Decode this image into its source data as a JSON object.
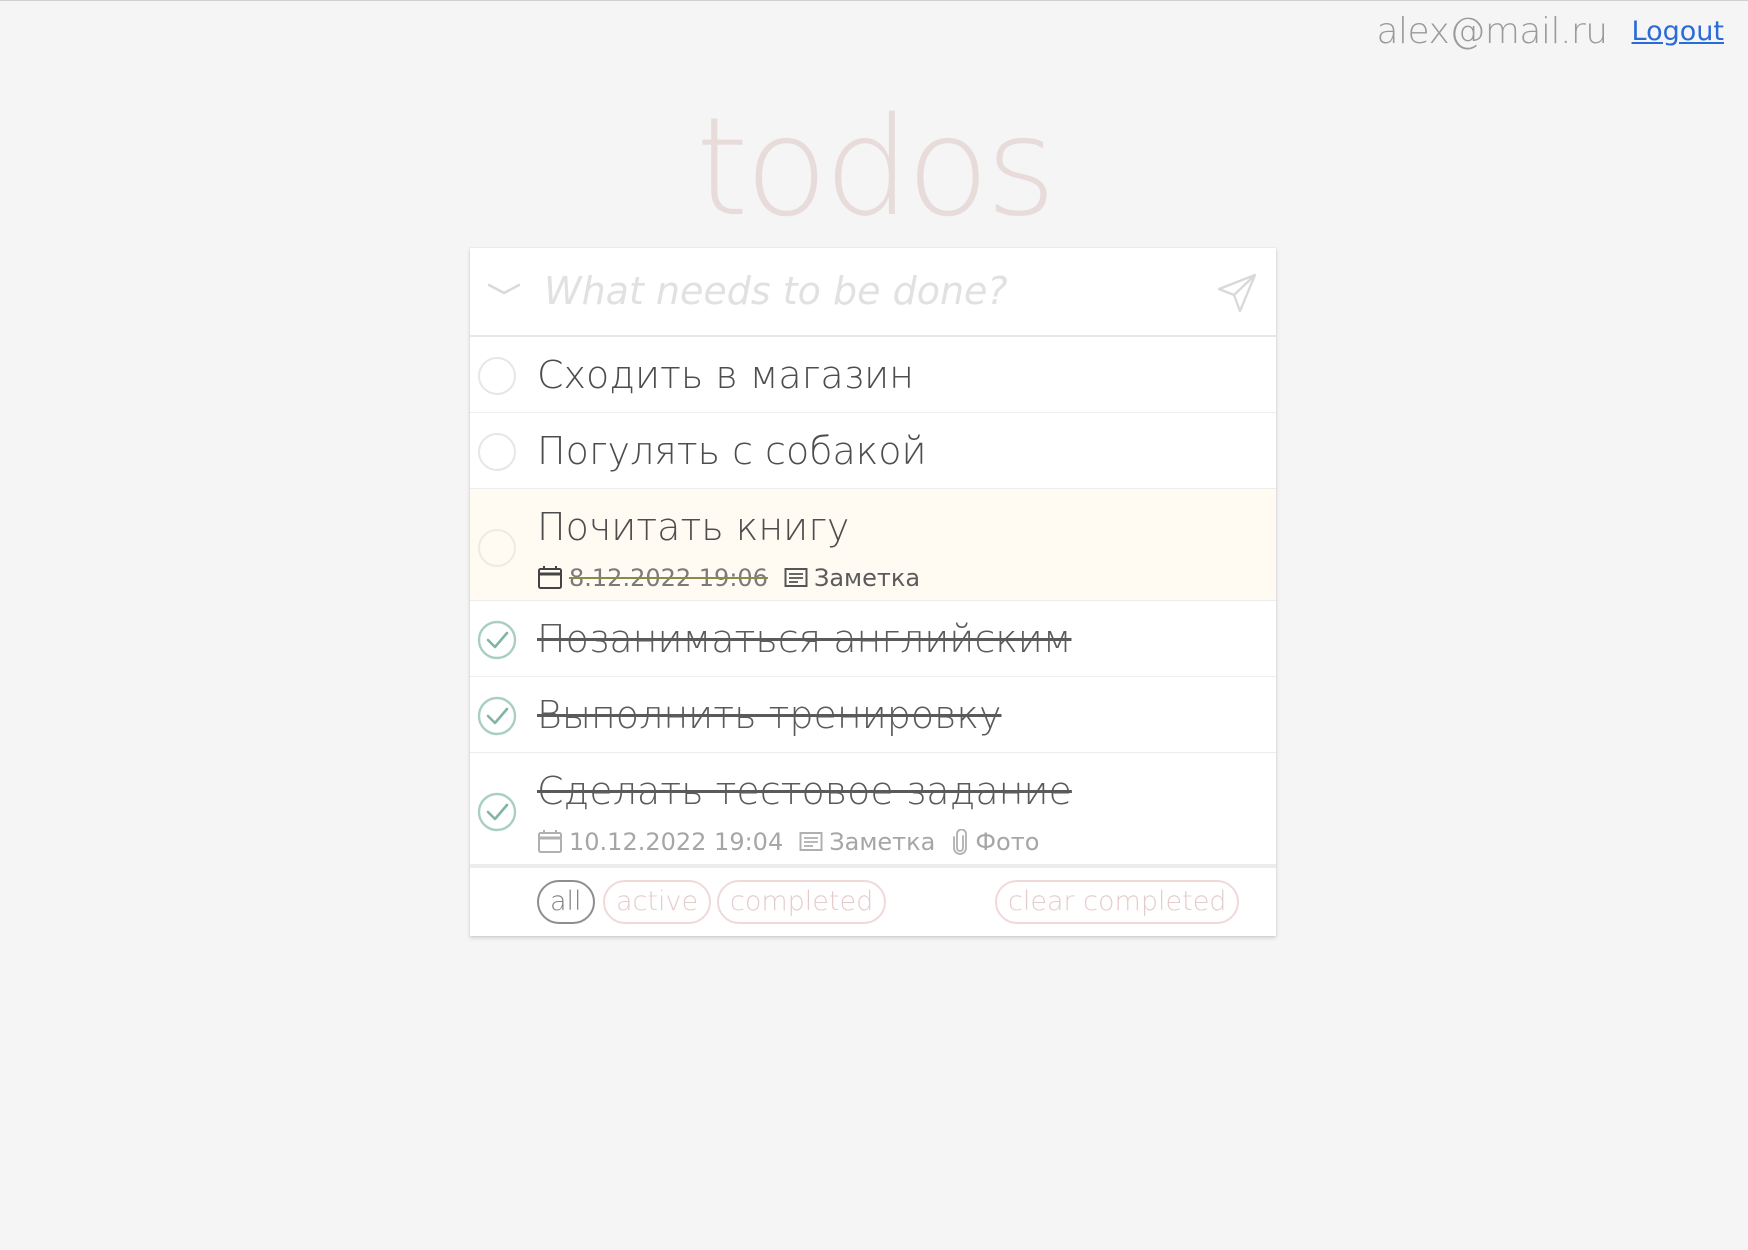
{
  "header": {
    "user_email": "alex@mail.ru",
    "logout_label": "Logout"
  },
  "brand": "todos",
  "new_todo": {
    "placeholder": "What needs to be done?",
    "value": ""
  },
  "todos": [
    {
      "title": "Сходить в магазин",
      "completed": false
    },
    {
      "title": "Погулять с собакой",
      "completed": false
    },
    {
      "title": "Почитать книгу",
      "completed": false,
      "highlighted": true,
      "date": "8.12.2022 19:06",
      "date_overdue": true,
      "note_label": "Заметка"
    },
    {
      "title": "Позаниматься английским",
      "completed": true
    },
    {
      "title": "Выполнить тренировку",
      "completed": true
    },
    {
      "title": "Сделать тестовое задание",
      "completed": true,
      "date": "10.12.2022 19:04",
      "note_label": "Заметка",
      "attachment_label": "Фото"
    }
  ],
  "footer": {
    "filters": [
      {
        "label": "all",
        "selected": true
      },
      {
        "label": "active",
        "selected": false
      },
      {
        "label": "completed",
        "selected": false
      }
    ],
    "clear_label": "clear completed"
  },
  "colors": {
    "background": "#f5f5f5",
    "brand": "#e8dcdb",
    "check_green": "#8fbfae",
    "link_blue": "#2a6bd8",
    "highlight_row": "#fffbf3"
  },
  "icons": {
    "toggle_all": "chevron-down-icon",
    "send": "send-plane-icon",
    "complete": "check-circle-icon",
    "incomplete": "empty-circle-icon",
    "date": "calendar-icon",
    "note": "note-icon",
    "attachment": "paperclip-icon"
  }
}
